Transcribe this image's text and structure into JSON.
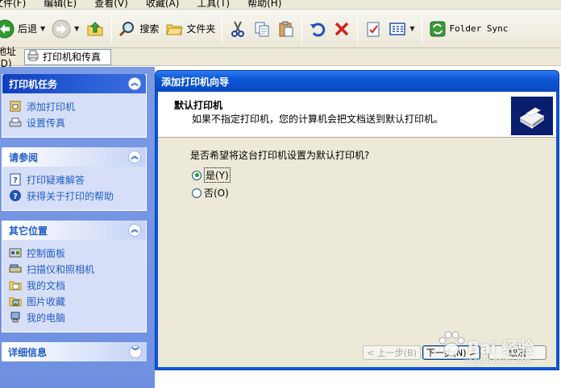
{
  "menu": [
    "文件(F)",
    "编辑(E)",
    "查看(V)",
    "收藏(A)",
    "工具(T)",
    "帮助(H)"
  ],
  "toolbar": {
    "back_label": "后退",
    "search_label": "搜索",
    "folders_label": "文件夹",
    "folder_sync_label": "Folder Sync"
  },
  "address": {
    "label": "地址(D)",
    "value": "打印机和传真"
  },
  "sidebar": {
    "printer_tasks": {
      "title": "打印机任务",
      "items": [
        "添加打印机",
        "设置传真"
      ]
    },
    "see_also": {
      "title": "请参阅",
      "items": [
        "打印疑难解答",
        "获得关于打印的帮助"
      ]
    },
    "other_places": {
      "title": "其它位置",
      "items": [
        "控制面板",
        "扫描仪和照相机",
        "我的文档",
        "图片收藏",
        "我的电脑"
      ]
    },
    "details": {
      "title": "详细信息"
    }
  },
  "wizard": {
    "title": "添加打印机向导",
    "heading": "默认打印机",
    "subheading": "如果不指定打印机，您的计算机会把文档送到默认打印机。",
    "question": "是否希望将这台打印机设置为默认打印机?",
    "options": [
      {
        "label": "是(Y)",
        "selected": true
      },
      {
        "label": "否(O)",
        "selected": false
      }
    ],
    "back_button": "< 上一步(B)",
    "next_button": "下一步(N) >",
    "cancel_button": "取消"
  },
  "watermark": {
    "text": "Bai 经验",
    "sub": "jingyan.baidu.com"
  },
  "colors": {
    "taskpane_bg": "#7a9ae6",
    "group_header": "#0f3fbe",
    "link": "#215dc6",
    "dialog_frame": "#0a58d8",
    "dialog_body": "#ece9d8"
  }
}
